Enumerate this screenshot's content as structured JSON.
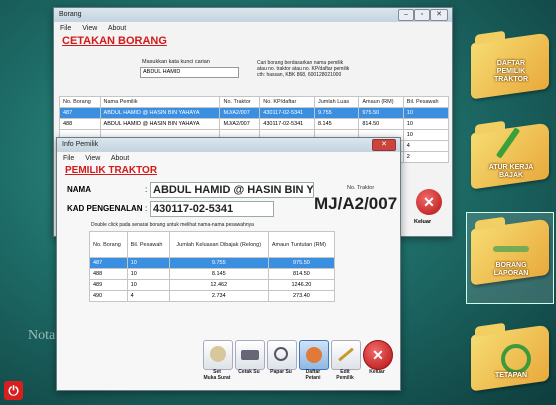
{
  "desktop": {
    "side_icons": [
      {
        "label": "DAFTAR\nPEMILIK\nTRAKTOR"
      },
      {
        "label": "ATUR KERJA\nBAJAK"
      },
      {
        "label": "BORANG\nLAPORAN"
      },
      {
        "label": "TETAPAN"
      }
    ],
    "watermark": "Nota"
  },
  "borang_window": {
    "title": "Borang",
    "menu": [
      "File",
      "View",
      "About"
    ],
    "heading": "CETAKAN BORANG",
    "search_label": "Masukkan kata kunci carian",
    "search_value": "ABDUL HAMID",
    "search_hint": "Cari borang berdasarkan nama pemilik\natau no. traktor atau no. KP/daftar pemilik\ncth: hassan, KBK 868, 600128021000",
    "columns": [
      "No. Borang",
      "Nama Pemilik",
      "No. Traktor",
      "No. KP/daftar",
      "Jumlah Luas",
      "Amaun (RM)",
      "Bil. Pesawah"
    ],
    "rows": [
      [
        "487",
        "ABDUL HAMID @ HASIN BIN YAHAYA",
        "MJ/A2/007",
        "430117-02-5341",
        "9.755",
        "975.50",
        "10"
      ],
      [
        "488",
        "ABDUL HAMID @ HASIN BIN YAHAYA",
        "MJ/A2/007",
        "430117-02-5341",
        "8.145",
        "814.50",
        "10"
      ],
      [
        "",
        "",
        "",
        "",
        "",
        "",
        "10"
      ],
      [
        "",
        "",
        "",
        "",
        "",
        "",
        "4"
      ],
      [
        "",
        "",
        "",
        "",
        "",
        "",
        "2"
      ]
    ],
    "keluar": "Keluar"
  },
  "info_window": {
    "title": "Info Pemilik",
    "menu": [
      "File",
      "View",
      "About"
    ],
    "heading": "PEMILIK TRAKTOR",
    "nama_label": "NAMA",
    "nama_value": "ABDUL HAMID @ HASIN BIN YAH",
    "kp_label": "KAD PENGENALAN",
    "kp_value": "430117-02-5341",
    "traktor_label": "No. Traktor",
    "traktor_value": "MJ/A2/007",
    "instruction": "Double click pada senarai borang untuk melihat nama-nama pesawahnya",
    "columns": [
      "No. Borang",
      "Bil. Pesawah",
      "Jumlah Keluasan Dibajak (Relong)",
      "Amaun Tuntutan (RM)"
    ],
    "rows": [
      [
        "487",
        "10",
        "9.755",
        "975.50"
      ],
      [
        "488",
        "10",
        "8.145",
        "814.50"
      ],
      [
        "489",
        "10",
        "12.462",
        "1246.20"
      ],
      [
        "490",
        "4",
        "2.734",
        "273.40"
      ]
    ],
    "toolbar": [
      {
        "label": "Set\nMuka Surat",
        "icon": "coins-icon"
      },
      {
        "label": "Cetak Su",
        "icon": "print-icon"
      },
      {
        "label": "Papar Su",
        "icon": "magnifier-icon"
      },
      {
        "label": "Daftar\nPetani",
        "icon": "users-icon"
      },
      {
        "label": "Edit\nPemilik",
        "icon": "pencil-icon"
      },
      {
        "label": "Keluar",
        "icon": "close-icon"
      }
    ]
  }
}
